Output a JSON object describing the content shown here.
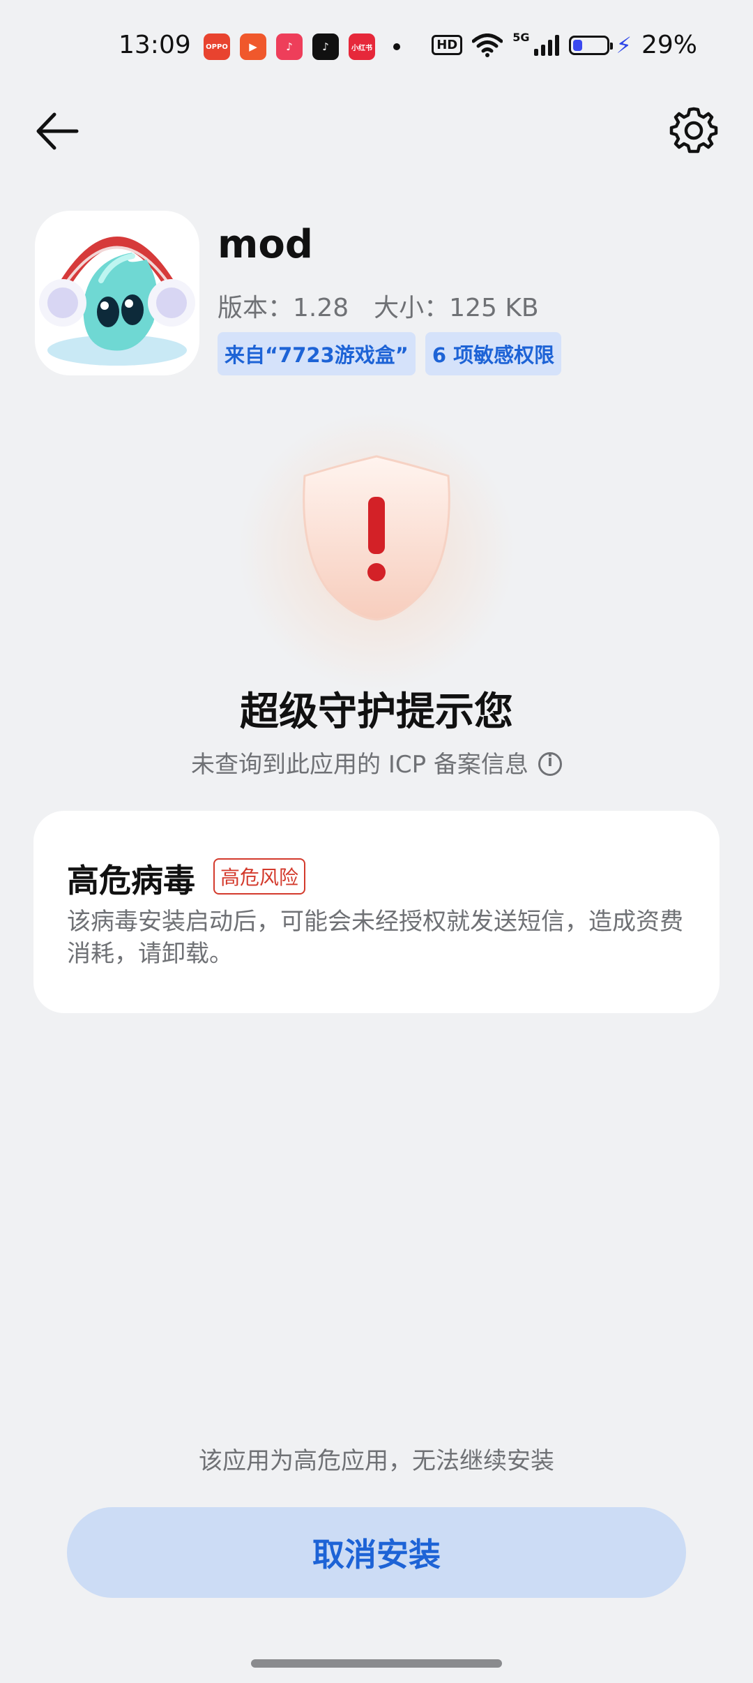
{
  "status_bar": {
    "time": "13:09",
    "notification_apps": [
      {
        "name": "oppo-app-icon",
        "color": "#e8432f",
        "label": "OPPO"
      },
      {
        "name": "video-app-icon",
        "color": "#f0582c",
        "label": "▶"
      },
      {
        "name": "music-app-icon",
        "color": "#ee3e5a",
        "label": "♪"
      },
      {
        "name": "tiktok-icon",
        "color": "#111111",
        "label": "♪"
      },
      {
        "name": "xiaohongshu-icon",
        "color": "#e6283a",
        "label": "小红书"
      }
    ],
    "hd_label": "HD",
    "network_label": "5G",
    "battery_percent": "29%",
    "battery_level": 0.29
  },
  "app": {
    "name": "mod",
    "version_label": "版本：1.28",
    "size_label": "大小：125 KB",
    "source_chip": "来自“7723游戏盒”",
    "permissions_chip": "6 项敏感权限"
  },
  "warning": {
    "title": "超级守护提示您",
    "subtitle": "未查询到此应用的 ICP 备案信息"
  },
  "risk_card": {
    "title": "高危病毒",
    "badge": "高危风险",
    "description": "该病毒安装启动后，可能会未经授权就发送短信，造成资费消耗，请卸载。"
  },
  "footer": {
    "note": "该应用为高危应用，无法继续安装",
    "cancel_label": "取消安装"
  },
  "colors": {
    "accent_blue": "#1d63d6",
    "danger_red": "#d33a2c",
    "background": "#f0f1f3"
  }
}
